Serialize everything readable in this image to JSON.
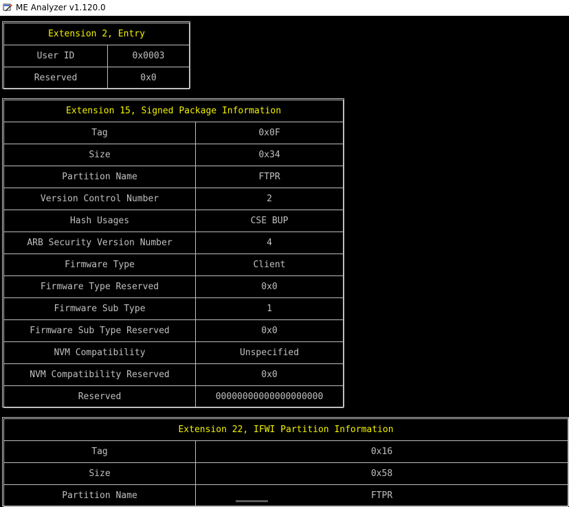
{
  "window": {
    "title": "ME Analyzer v1.120.0",
    "icon": "me-analyzer-app-icon"
  },
  "tables": [
    {
      "title": "Extension 2, Entry",
      "rows": [
        {
          "label": "User ID",
          "value": "0x0003"
        },
        {
          "label": "Reserved",
          "value": "0x0"
        }
      ]
    },
    {
      "title": "Extension 15, Signed Package Information",
      "rows": [
        {
          "label": "Tag",
          "value": "0x0F"
        },
        {
          "label": "Size",
          "value": "0x34"
        },
        {
          "label": "Partition Name",
          "value": "FTPR"
        },
        {
          "label": "Version Control Number",
          "value": "2"
        },
        {
          "label": "Hash Usages",
          "value": "CSE BUP"
        },
        {
          "label": "ARB Security Version Number",
          "value": "4"
        },
        {
          "label": "Firmware Type",
          "value": "Client"
        },
        {
          "label": "Firmware Type Reserved",
          "value": "0x0"
        },
        {
          "label": "Firmware Sub Type",
          "value": "1"
        },
        {
          "label": "Firmware Sub Type Reserved",
          "value": "0x0"
        },
        {
          "label": "NVM Compatibility",
          "value": "Unspecified"
        },
        {
          "label": "NVM Compatibility Reserved",
          "value": "0x0"
        },
        {
          "label": "Reserved",
          "value": "00000000000000000000"
        }
      ]
    },
    {
      "title": "Extension 22, IFWI Partition Information",
      "rows": [
        {
          "label": "Tag",
          "value": "0x16"
        },
        {
          "label": "Size",
          "value": "0x58"
        },
        {
          "label": "Partition Name",
          "value": "FTPR"
        }
      ]
    }
  ],
  "colors": {
    "background": "#000000",
    "text": "#c0c0c0",
    "heading": "#f2f200",
    "border": "#c0c0c0"
  }
}
